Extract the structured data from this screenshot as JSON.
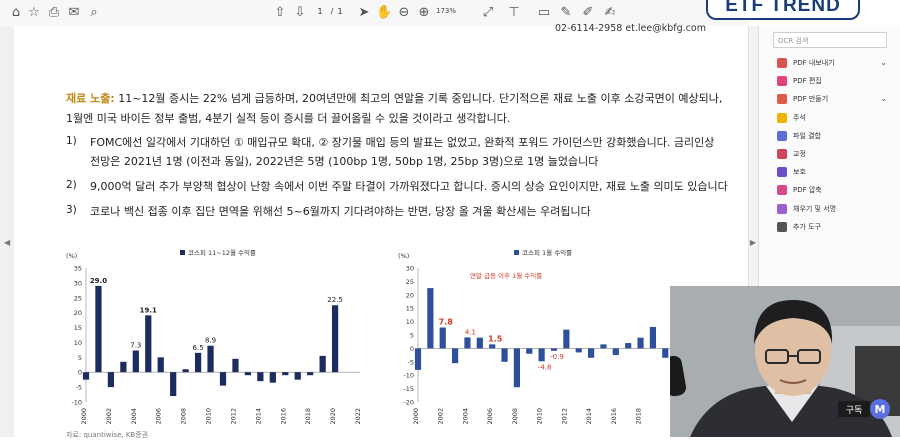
{
  "brand": {
    "logo_text": "ETF TREND"
  },
  "toolbar": {
    "page_current": "1",
    "page_separator": "/",
    "page_total": "1",
    "zoom": "173%",
    "icons": [
      "home-icon",
      "star-icon",
      "print-icon",
      "mail-icon",
      "search-icon",
      "up-icon",
      "down-icon",
      "cursor-icon",
      "hand-icon",
      "zoom-out-icon",
      "zoom-in-icon",
      "fit-icon",
      "stamp-icon",
      "comment-icon",
      "pen-icon",
      "highlight-icon",
      "sign-icon"
    ]
  },
  "right_panel": {
    "search_placeholder": "OCR 검색",
    "tools": [
      {
        "label": "PDF 내보내기",
        "color": "#d9534f",
        "chevron": "⌄"
      },
      {
        "label": "PDF 편집",
        "color": "#e0447a",
        "chevron": ""
      },
      {
        "label": "PDF 만들기",
        "color": "#e05a4a",
        "chevron": "⌄"
      },
      {
        "label": "주석",
        "color": "#f0b400",
        "chevron": ""
      },
      {
        "label": "파일 결합",
        "color": "#5a6fd6",
        "chevron": ""
      },
      {
        "label": "교정",
        "color": "#d0445a",
        "chevron": ""
      },
      {
        "label": "보호",
        "color": "#6a4fc8",
        "chevron": ""
      },
      {
        "label": "PDF 압축",
        "color": "#d64a8a",
        "chevron": ""
      },
      {
        "label": "채우기 및 서명",
        "color": "#9a5fd0",
        "chevron": ""
      },
      {
        "label": "추가 도구",
        "color": "#555555",
        "chevron": ""
      }
    ]
  },
  "document": {
    "contact": "02-6114-2958  et.lee@kbfg.com",
    "para_highlight": "재료 노출:",
    "para_line1": " 11~12월 증시는 22% 넘게 급등하며, 20여년만에 최고의 연말을 기록 중입니다. 단기적으론 재료 노출 이후 소강국면이 예상되나,",
    "para_line2": "1월엔 미국 바이든 정부 출범, 4분기 실적 등이 증시를 더 끌어올릴 수 있을 것이라고 생각합니다.",
    "items": [
      {
        "num": "1)",
        "line1": "FOMC에선 일각에서 기대하던 ① 매입규모 확대, ② 장기물 매입 등의 발표는 없었고, 완화적 포워드 가이던스만 강화했습니다. 금리인상",
        "line2": "전망은 2021년 1명 (이전과 동일), 2022년은 5명 (100bp 1명, 50bp 1명, 25bp 3명)으로 1명 늘었습니다"
      },
      {
        "num": "2)",
        "line1": "9,000억 달러 추가 부양책 협상이 난항 속에서 이번 주말 타결이 가까워졌다고 합니다. 증시의 상승 요인이지만, 재료 노출 의미도 있습니다",
        "line2": ""
      },
      {
        "num": "3)",
        "line1": "코로나 백신 접종 이후 집단 면역을 위해선 5~6월까지 기다려야하는 반면, 당장 올 겨울 확산세는 우려됩니다",
        "line2": ""
      }
    ],
    "source": "자료: quantiwise, KB증권"
  },
  "chart_data": [
    {
      "type": "bar",
      "title": "코스피 11~12월 수익률",
      "ylabel": "(%)",
      "ylim": [
        -10,
        35
      ],
      "yticks": [
        35,
        30,
        25,
        20,
        15,
        10,
        5,
        0,
        -5,
        -10
      ],
      "x": [
        2000,
        2001,
        2002,
        2003,
        2004,
        2005,
        2006,
        2007,
        2008,
        2009,
        2010,
        2011,
        2012,
        2013,
        2014,
        2015,
        2016,
        2017,
        2018,
        2019,
        2020
      ],
      "xticks": [
        2000,
        2002,
        2004,
        2006,
        2008,
        2010,
        2012,
        2014,
        2016,
        2018,
        2020,
        2022
      ],
      "values": [
        -2.5,
        29.0,
        -5.0,
        3.5,
        7.3,
        19.1,
        5.0,
        -8.0,
        1.0,
        6.5,
        8.9,
        -4.5,
        4.5,
        -1.0,
        -3.0,
        -3.5,
        -1.0,
        -2.5,
        -1.0,
        5.5,
        22.5
      ],
      "data_labels": [
        {
          "x": 2001,
          "text": "29.0"
        },
        {
          "x": 2004,
          "text": "7.3"
        },
        {
          "x": 2005,
          "text": "19.1"
        },
        {
          "x": 2009,
          "text": "6.5"
        },
        {
          "x": 2010,
          "text": "8.9"
        },
        {
          "x": 2020,
          "text": "22.5"
        }
      ],
      "color": "#1c2c5e",
      "legend_position": "top"
    },
    {
      "type": "bar",
      "title": "코스피 1월 수익률",
      "annotation": "연말 급등 이후 1월 수익률",
      "ylabel": "(%)",
      "ylim": [
        -20,
        30
      ],
      "yticks": [
        30,
        25,
        20,
        15,
        10,
        5,
        0,
        -5,
        -10,
        -15,
        -20
      ],
      "x": [
        2000,
        2001,
        2002,
        2003,
        2004,
        2005,
        2006,
        2007,
        2008,
        2009,
        2010,
        2011,
        2012,
        2013,
        2014,
        2015,
        2016,
        2017,
        2018,
        2019,
        2020
      ],
      "xticks": [
        2000,
        2002,
        2004,
        2006,
        2008,
        2010,
        2012,
        2014,
        2016,
        2018
      ],
      "values": [
        -8.0,
        22.5,
        7.8,
        -5.5,
        4.1,
        4.0,
        1.5,
        -5.0,
        -14.5,
        -2.0,
        -4.8,
        -0.9,
        7.0,
        -1.5,
        -3.5,
        1.5,
        -2.5,
        2.0,
        4.0,
        8.0,
        -3.5
      ],
      "data_labels": [
        {
          "x": 2002,
          "text": "7.8",
          "red": true,
          "bold": true
        },
        {
          "x": 2004,
          "text": "4.1",
          "red": true
        },
        {
          "x": 2006,
          "text": "1.5",
          "red": true,
          "bold": true
        },
        {
          "x": 2010,
          "text": "-4.8",
          "red": true
        },
        {
          "x": 2011,
          "text": "-0.9",
          "red": true
        }
      ],
      "color": "#2f4f9c",
      "annotation_color": "#d03a2a",
      "legend_position": "top"
    }
  ],
  "video_overlay": {
    "badge_text": "구독",
    "badge_logo": "M"
  }
}
